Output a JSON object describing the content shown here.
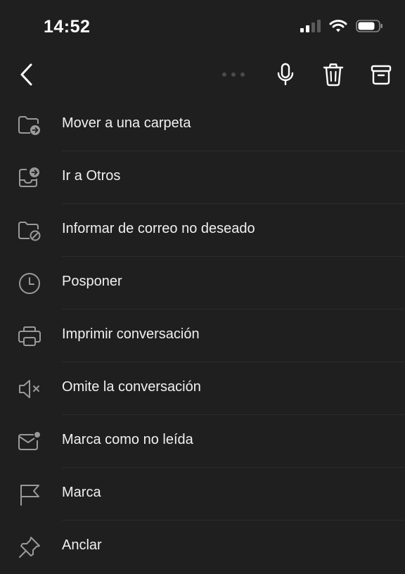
{
  "status_bar": {
    "time": "14:52",
    "icons": [
      "cellular-signal-icon",
      "wifi-icon",
      "battery-icon"
    ]
  },
  "toolbar": {
    "back": "chevron-left-icon",
    "drag": "more-dots-icon",
    "mic": "microphone-icon",
    "delete": "trash-icon",
    "archive": "archive-icon"
  },
  "menu": {
    "items": [
      {
        "label": "Mover a una carpeta",
        "icon": "folder-move-icon"
      },
      {
        "label": "Ir a Otros",
        "icon": "inbox-move-icon"
      },
      {
        "label": "Informar de correo no deseado",
        "icon": "folder-block-icon"
      },
      {
        "label": "Posponer",
        "icon": "clock-icon"
      },
      {
        "label": "Imprimir conversación",
        "icon": "printer-icon"
      },
      {
        "label": "Omite la conversación",
        "icon": "speaker-mute-icon"
      },
      {
        "label": "Marca como no leída",
        "icon": "mail-unread-icon"
      },
      {
        "label": "Marca",
        "icon": "flag-icon"
      },
      {
        "label": "Anclar",
        "icon": "pin-icon"
      }
    ]
  },
  "colors": {
    "background": "#1f1f1f",
    "text": "#f0f0f0",
    "icon": "#9a9a9a",
    "separator": "#2c2c2c"
  }
}
